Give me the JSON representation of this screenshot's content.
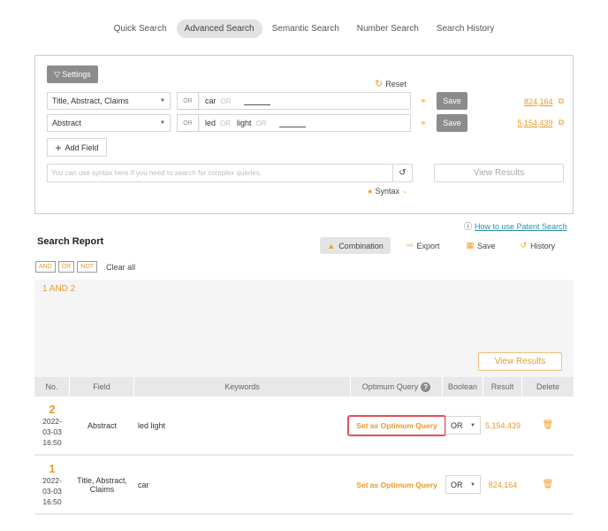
{
  "tabs": [
    {
      "label": "Quick Search",
      "active": false
    },
    {
      "label": "Advanced Search",
      "active": true
    },
    {
      "label": "Semantic Search",
      "active": false
    },
    {
      "label": "Number Search",
      "active": false
    },
    {
      "label": "Search History",
      "active": false
    }
  ],
  "panel": {
    "settings_label": "Settings",
    "reset_label": "Reset",
    "fields": [
      {
        "field": "Title, Abstract, Claims",
        "operator": "OR",
        "keywords": [
          "car"
        ],
        "joiner": "OR",
        "save_label": "Save",
        "count": "824,164"
      },
      {
        "field": "Abstract",
        "operator": "OR",
        "keywords": [
          "led",
          "light"
        ],
        "joiner": "OR",
        "save_label": "Save",
        "count": "5,154,439"
      }
    ],
    "add_field_label": "Add Field",
    "syntax_placeholder": "You can use syntax here if you need to search for complex queries.",
    "syntax_label": "Syntax",
    "view_results_label": "View Results"
  },
  "help_link": "How to use Patent Search",
  "report": {
    "title": "Search Report",
    "actions": [
      {
        "label": "Combination",
        "icon": "combination-icon",
        "active": true
      },
      {
        "label": "Export",
        "icon": "export-icon",
        "active": false
      },
      {
        "label": "Save",
        "icon": "save-icon",
        "active": false
      },
      {
        "label": "History",
        "icon": "history-icon",
        "active": false
      }
    ],
    "bool_buttons": [
      "AND",
      "OR",
      "NOT"
    ],
    "clear_all_label": "Clear all",
    "combination_query": "1 AND 2",
    "view_results_label": "View Results"
  },
  "table": {
    "headers": {
      "no": "No.",
      "field": "Field",
      "keywords": "Keywords",
      "optimum": "Optimum Query",
      "boolean": "Boolean",
      "result": "Result",
      "delete": "Delete"
    },
    "rows": [
      {
        "no": "2",
        "date": "2022-\n03-03\n16:50",
        "date_lines": [
          "2022-",
          "03-03",
          "16:50"
        ],
        "field": "Abstract",
        "keywords": "led light",
        "optimum_label": "Set as Optimum Query",
        "optimum_selected": true,
        "boolean": "OR",
        "result": "5,154,439"
      },
      {
        "no": "1",
        "date_lines": [
          "2022-",
          "03-03",
          "16:50"
        ],
        "field": "Title, Abstract, Claims",
        "keywords": "car",
        "optimum_label": "Set as Optimum Query",
        "optimum_selected": false,
        "boolean": "OR",
        "result": "824,164"
      }
    ]
  },
  "colors": {
    "accent": "#e99a26",
    "button_gray": "#8c8c8c",
    "highlight_border": "#e0505a",
    "link": "#2a8fb0"
  }
}
